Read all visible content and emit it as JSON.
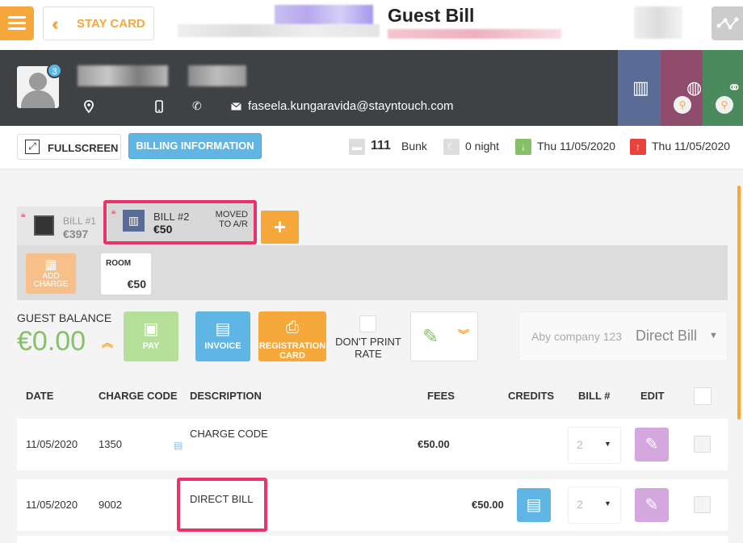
{
  "header": {
    "stay_card_label": "STAY CARD",
    "page_title": "Guest Bill"
  },
  "guest": {
    "reservation_count": "3",
    "email": "faseela.kungaravida@stayntouch.com"
  },
  "actions": {
    "fullscreen_label": "FULLSCREEN",
    "billing_info_label": "BILLING INFORMATION",
    "room_number": "111",
    "room_type": "Bunk",
    "nights": "0 night",
    "arrival": "Thu 11/05/2020",
    "departure": "Thu 11/05/2020"
  },
  "bills": [
    {
      "label": "BILL #1",
      "amount": "€397"
    },
    {
      "label": "BILL #2",
      "amount": "€50",
      "status_line1": "MOVED",
      "status_line2": "TO A/R"
    }
  ],
  "add_bill_label": "+",
  "panel": {
    "add_charge_line1": "ADD",
    "add_charge_line2": "CHARGE",
    "room_label": "ROOM",
    "room_amount": "€50"
  },
  "balance": {
    "label": "GUEST BALANCE",
    "value": "€0.00"
  },
  "buttons": {
    "pay": "PAY",
    "invoice": "INVOICE",
    "registration_line1": "REGISTRATION",
    "registration_line2": "CARD",
    "dont_print_line1": "DON'T PRINT",
    "dont_print_line2": "RATE"
  },
  "ar_account": {
    "company": "Aby company 123",
    "bill_type": "Direct Bill"
  },
  "table": {
    "headers": [
      "DATE",
      "CHARGE CODE",
      "DESCRIPTION",
      "FEES",
      "CREDITS",
      "BILL #",
      "EDIT"
    ],
    "rows": [
      {
        "date": "11/05/2020",
        "code": "1350",
        "description": "CHARGE CODE",
        "fees": "€50.00",
        "credits": "",
        "bill": "2"
      },
      {
        "date": "11/05/2020",
        "code": "9002",
        "description": "DIRECT BILL",
        "fees": "",
        "credits": "€50.00",
        "bill": "2"
      }
    ]
  },
  "colors": {
    "accent_orange": "#f6a83a",
    "accent_blue": "#5fb6e5",
    "balance_green": "#86c06a",
    "highlight_pink": "#e8336b",
    "header_dark": "#3e4245"
  }
}
